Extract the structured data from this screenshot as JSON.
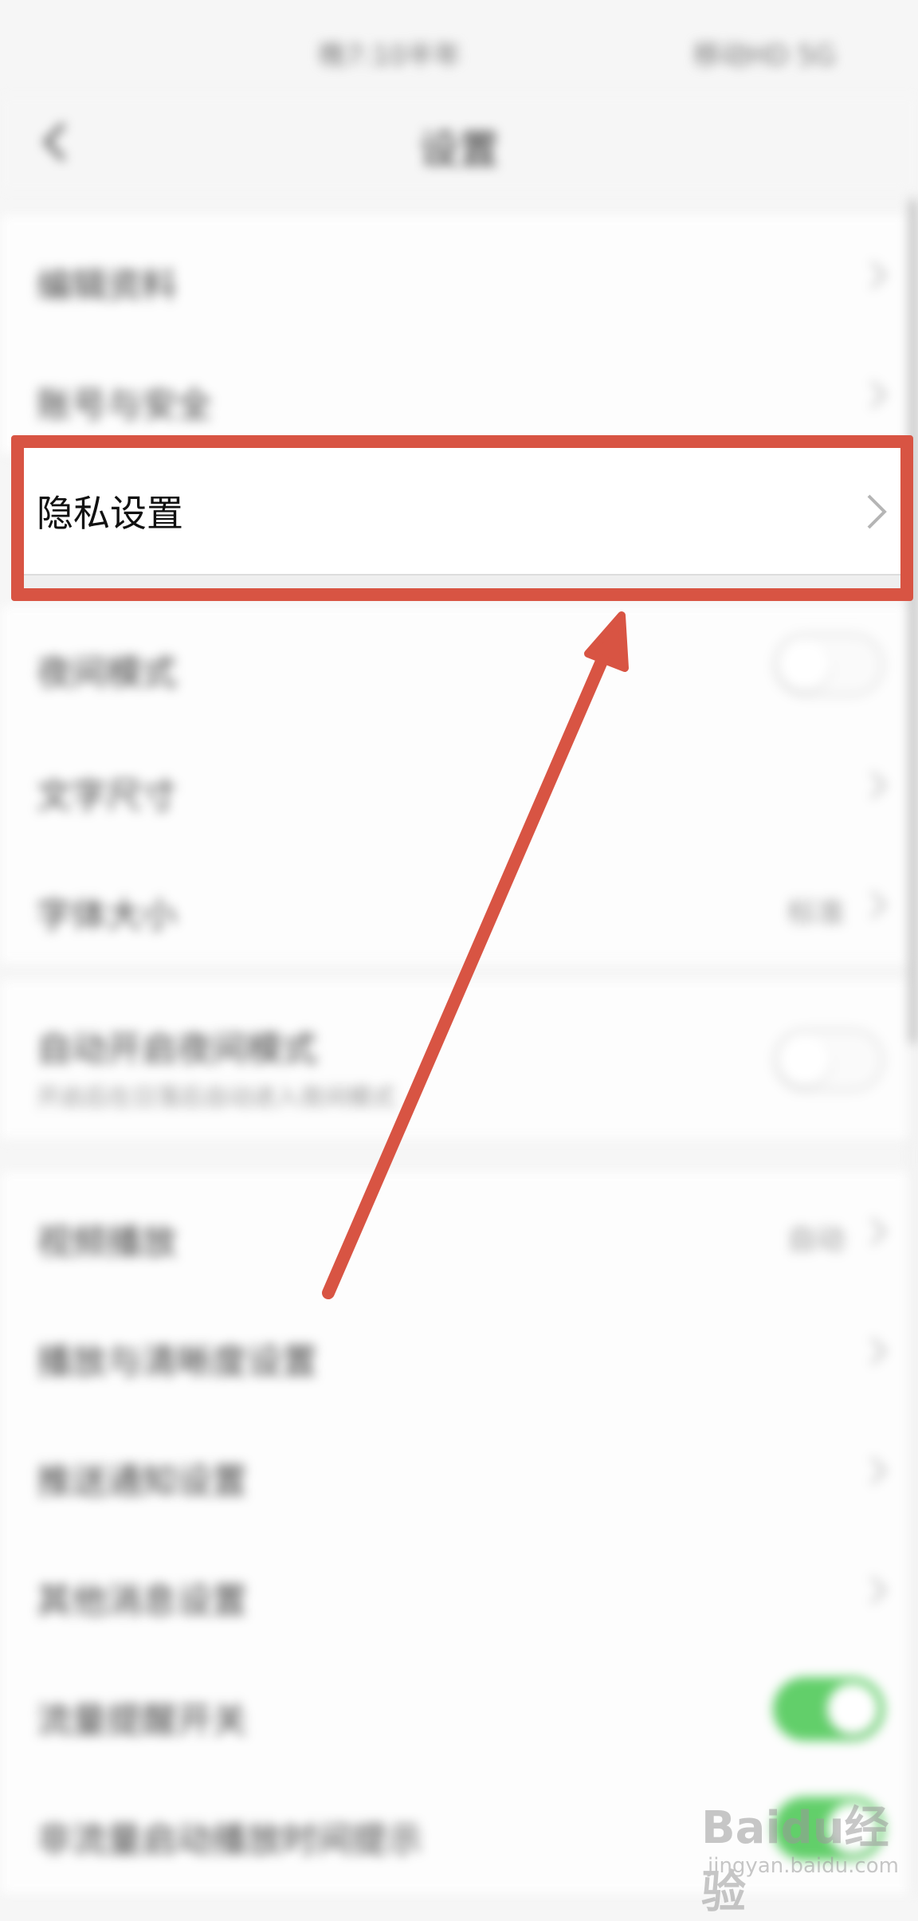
{
  "status_bar": {
    "left_text": "晚7:10半年",
    "right_text": "移动HD 5G"
  },
  "header": {
    "title": "设置"
  },
  "rows": [
    {
      "label": "编辑资料"
    },
    {
      "label": "账号与安全"
    },
    {
      "label": "夜间模式"
    },
    {
      "label": "文字尺寸"
    },
    {
      "label": "字体大小",
      "value": "标准"
    },
    {
      "label": "自动开启夜间模式",
      "sub": "开启后在日落后自动进入夜间模式"
    },
    {
      "label": "视频播放",
      "value": "自动"
    },
    {
      "label": "播放与清晰度设置"
    },
    {
      "label": "推送通知设置"
    },
    {
      "label": "其他消息设置"
    },
    {
      "label": "流量提醒开关"
    },
    {
      "label": "非流量启动播放时间提示"
    }
  ],
  "privacy_row": {
    "label": "隐私设置"
  },
  "watermark": {
    "text": "Baidu经验",
    "url_text": "jingyan.baidu.com"
  },
  "colors": {
    "highlight": "#d85443",
    "toggle_on": "#62cf6a"
  }
}
